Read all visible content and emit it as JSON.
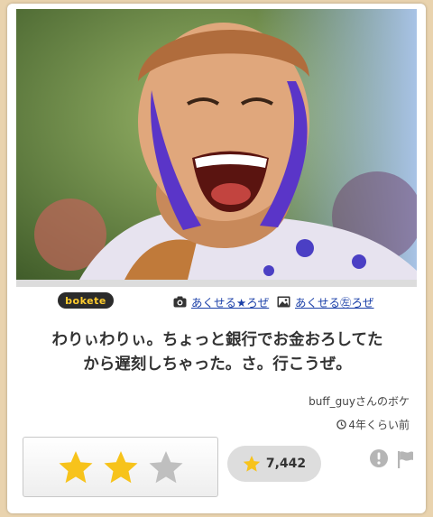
{
  "logo": {
    "text": "bokete",
    "icon": "bokete-logo"
  },
  "photo": {
    "alt_icon": "photo"
  },
  "links": {
    "image_search": {
      "label": "あくせる★ろぜ",
      "icon": "camera-icon"
    },
    "image_owner": {
      "label": "あくせる㊧ろぜ",
      "icon": "image-icon"
    }
  },
  "caption": {
    "line1": "わりぃわりぃ。ちょっと銀行でお金おろしてた",
    "line2": "から遅刻しちゃった。さ。行こうぜ。"
  },
  "author": "buff_guyさんのボケ",
  "time_ago": "4年くらい前",
  "rating": {
    "stars": [
      "filled",
      "filled",
      "empty"
    ],
    "count": "7,442"
  },
  "colors": {
    "star_filled": "#f7c31b",
    "star_empty": "#bfbfbf",
    "link": "#1a3fa8",
    "background": "#e9d3ae"
  }
}
